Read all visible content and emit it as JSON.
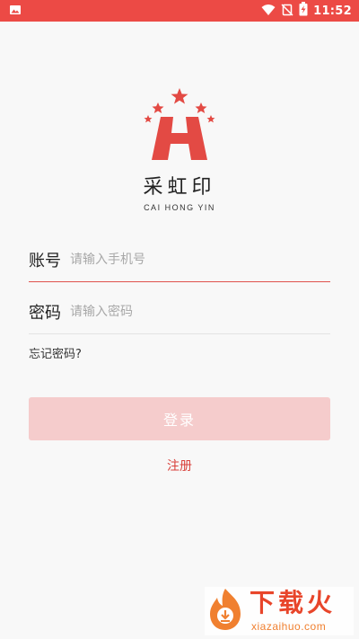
{
  "status_bar": {
    "time": "11:52",
    "icons": [
      "image-icon",
      "wifi-icon",
      "no-sim-icon",
      "battery-charging-icon"
    ],
    "color": "#ec4a45"
  },
  "logo": {
    "name": "采虹印",
    "subname": "CAI HONG YIN",
    "color": "#e34a44"
  },
  "form": {
    "phone_label": "账号",
    "phone_placeholder": "请输入手机号",
    "password_label": "密码",
    "password_placeholder": "请输入密码",
    "forgot_label": "忘记密码?",
    "login_label": "登录",
    "register_label": "注册"
  },
  "watermark": {
    "brand": "下载火",
    "domain": "xiazaihuo.com"
  }
}
